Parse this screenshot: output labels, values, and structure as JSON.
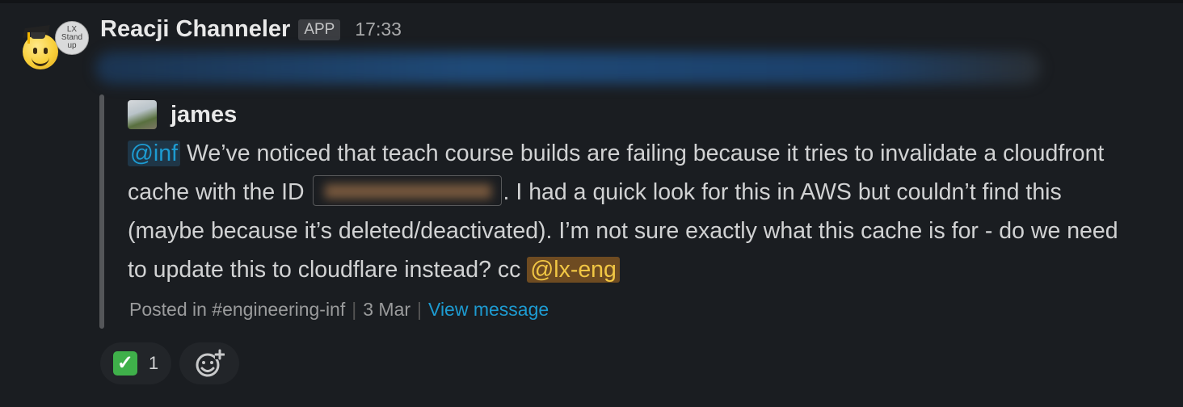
{
  "message": {
    "sender": "Reacji Channeler",
    "app_badge": "APP",
    "time": "17:33",
    "avatar_badge_text": [
      "LX",
      "Stand",
      "up"
    ]
  },
  "quote": {
    "author": "james",
    "mention_inf": "@inf",
    "text_part1": " We’ve noticed that teach course builds are failing because it tries to invalidate a cloudfront cache with the ID ",
    "text_part2": ". I had a quick look for this in AWS but couldn’t find this (maybe because it’s deleted/deactivated). I’m not sure exactly what this cache is for - do we need to update this to cloudflare instead? cc ",
    "mention_group": "@lx-eng",
    "posted_in": "Posted in #engineering-inf",
    "date": "3 Mar",
    "view_link": "View message"
  },
  "reactions": [
    {
      "emoji_name": "white-check-mark",
      "glyph": "✓",
      "count": "1"
    }
  ],
  "colors": {
    "background": "#1a1d21",
    "mention": "#1d9bd1",
    "group_mention_bg": "#6e4b21",
    "group_mention_text": "#f2c744",
    "link": "#1d9bd1"
  }
}
